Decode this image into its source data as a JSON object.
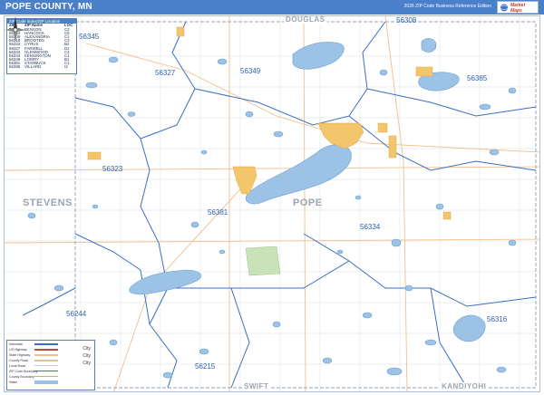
{
  "header": {
    "title": "POPE COUNTY, MN",
    "edition": "2026 ZIP Code Business Reference Edition",
    "brand": "Market Maps"
  },
  "zip_table": {
    "caption": "ZIP Code Index/ZIP Location",
    "columns": [
      "ZIP Code",
      "ZIP Name",
      "LOC"
    ],
    "rows": [
      [
        "56215",
        "BENSON",
        "C2"
      ],
      [
        "56244",
        "HANCOCK",
        "C5"
      ],
      [
        "56308",
        "ALEXANDRIA",
        "C1"
      ],
      [
        "56318",
        "BROOTEN",
        "C3"
      ],
      [
        "56323",
        "CYRUS",
        "B2"
      ],
      [
        "56327",
        "FARWELL",
        "D2"
      ],
      [
        "56334",
        "GLENWOOD",
        "C4"
      ],
      [
        "56343",
        "KENSINGTON",
        "C1"
      ],
      [
        "56349",
        "LOWRY",
        "B1"
      ],
      [
        "56381",
        "STARBUCK",
        "C1"
      ],
      [
        "56385",
        "VILLARD",
        "I2"
      ]
    ]
  },
  "map": {
    "county_labels": [
      {
        "name": "STEVENS",
        "id": "county-stevens"
      },
      {
        "name": "POPE",
        "id": "county-pope"
      },
      {
        "name": "DOUGLAS",
        "id": "county-douglas"
      },
      {
        "name": "SWIFT",
        "id": "county-swift"
      },
      {
        "name": "KANDIYOHI",
        "id": "county-kandiyohi"
      }
    ],
    "zip_labels": [
      "56345",
      "56308",
      "56327",
      "56349",
      "56385",
      "56323",
      "56381",
      "56334",
      "56244",
      "56316",
      "56215"
    ],
    "colors": {
      "water": "#9cc3e6",
      "water_stroke": "#6a9fd1",
      "urban": "#f3c66b",
      "park": "#c9e2b8",
      "zip_boundary": "#3a6fc4",
      "road": "#f0c18a",
      "section_line": "#e3e7ee"
    }
  },
  "legend": {
    "rows": [
      "Interstate",
      "US Highway",
      "State Highway",
      "County Road",
      "Local Road",
      "ZIP Code Boundary",
      "County Boundary",
      "Water"
    ],
    "cities": [
      "City",
      "City",
      "City"
    ]
  }
}
